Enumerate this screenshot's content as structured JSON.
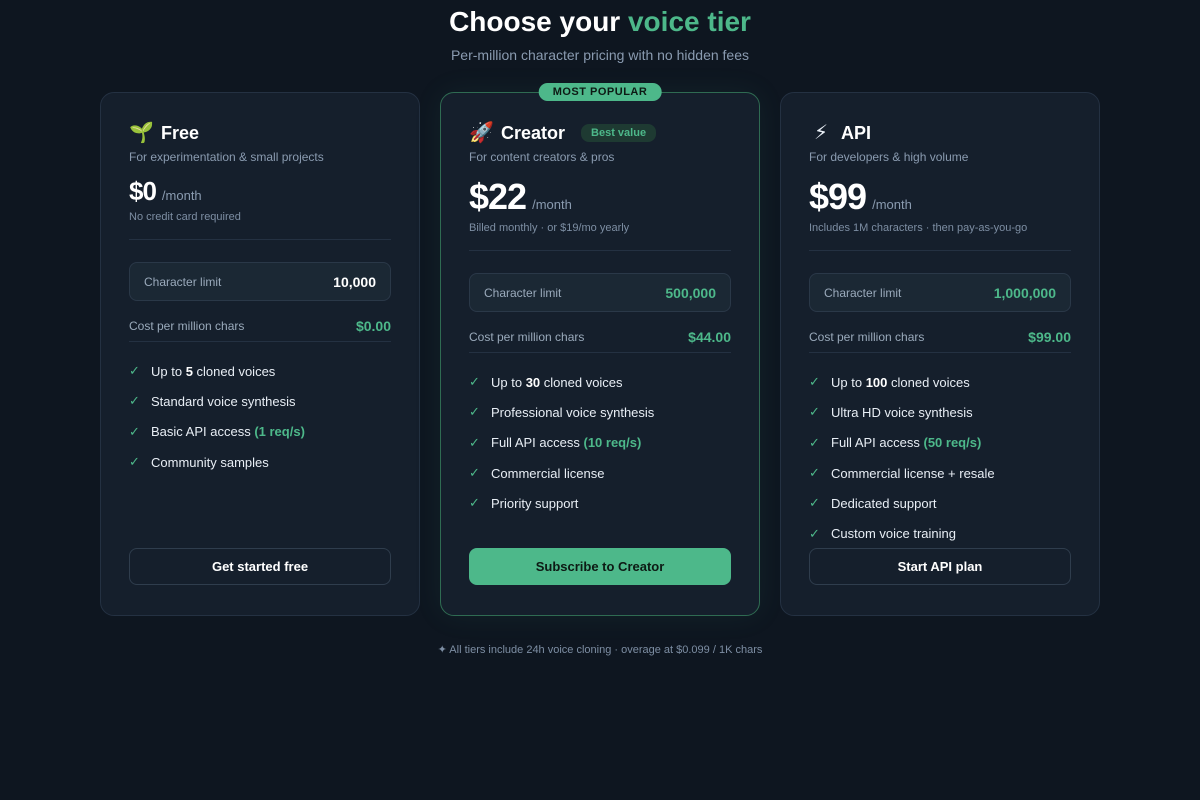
{
  "header": {
    "title_main": "Choose your",
    "title_accent": "voice tier",
    "subtitle": "Per-million character pricing with no hidden fees"
  },
  "plans": [
    {
      "icon": "seedling-icon",
      "icon_glyph": "🌱",
      "name": "Free",
      "tag": "",
      "popular_badge": "",
      "description": "For experimentation & small projects",
      "price": "$0",
      "period": "/month",
      "price_note": "No credit card required",
      "limit_label": "Character limit",
      "limit_value": "10,000",
      "cost_label": "Cost per million chars",
      "cost_value": "$0.00",
      "features": [
        {
          "pre": "Up to ",
          "bold": "5",
          "post": " cloned voices",
          "hl": ""
        },
        {
          "pre": "Standard voice synthesis",
          "bold": "",
          "post": "",
          "hl": ""
        },
        {
          "pre": "Basic API access ",
          "bold": "",
          "post": "",
          "hl": "(1 req/s)"
        },
        {
          "pre": "Community samples",
          "bold": "",
          "post": "",
          "hl": ""
        }
      ],
      "cta": "Get started free"
    },
    {
      "icon": "rocket-icon",
      "icon_glyph": "🚀",
      "name": "Creator",
      "tag": "Best value",
      "popular_badge": "MOST POPULAR",
      "description": "For content creators & pros",
      "price": "$22",
      "period": "/month",
      "price_note": "Billed monthly · or $19/mo yearly",
      "limit_label": "Character limit",
      "limit_value": "500,000",
      "cost_label": "Cost per million chars",
      "cost_value": "$44.00",
      "features": [
        {
          "pre": "Up to ",
          "bold": "30",
          "post": " cloned voices",
          "hl": ""
        },
        {
          "pre": "Professional voice synthesis",
          "bold": "",
          "post": "",
          "hl": ""
        },
        {
          "pre": "Full API access ",
          "bold": "",
          "post": "",
          "hl": "(10 req/s)"
        },
        {
          "pre": "Commercial license",
          "bold": "",
          "post": "",
          "hl": ""
        },
        {
          "pre": "Priority support",
          "bold": "",
          "post": "",
          "hl": ""
        }
      ],
      "cta": "Subscribe to Creator"
    },
    {
      "icon": "lightning-icon",
      "icon_glyph": "⚡",
      "name": "API",
      "tag": "",
      "popular_badge": "",
      "description": "For developers & high volume",
      "price": "$99",
      "period": "/month",
      "price_note": "Includes 1M characters · then pay-as-you-go",
      "limit_label": "Character limit",
      "limit_value": "1,000,000",
      "cost_label": "Cost per million chars",
      "cost_value": "$99.00",
      "features": [
        {
          "pre": "Up to ",
          "bold": "100",
          "post": " cloned voices",
          "hl": ""
        },
        {
          "pre": "Ultra HD voice synthesis",
          "bold": "",
          "post": "",
          "hl": ""
        },
        {
          "pre": "Full API access ",
          "bold": "",
          "post": "",
          "hl": "(50 req/s)"
        },
        {
          "pre": "Commercial license + resale",
          "bold": "",
          "post": "",
          "hl": ""
        },
        {
          "pre": "Dedicated support",
          "bold": "",
          "post": "",
          "hl": ""
        },
        {
          "pre": "Custom voice training",
          "bold": "",
          "post": "",
          "hl": ""
        }
      ],
      "cta": "Start API plan"
    }
  ],
  "footer": "✦ All tiers include 24h voice cloning · overage at $0.099 / 1K chars",
  "colors": {
    "background": "#0e1620",
    "card": "#151f2c",
    "accent": "#4db88a"
  }
}
